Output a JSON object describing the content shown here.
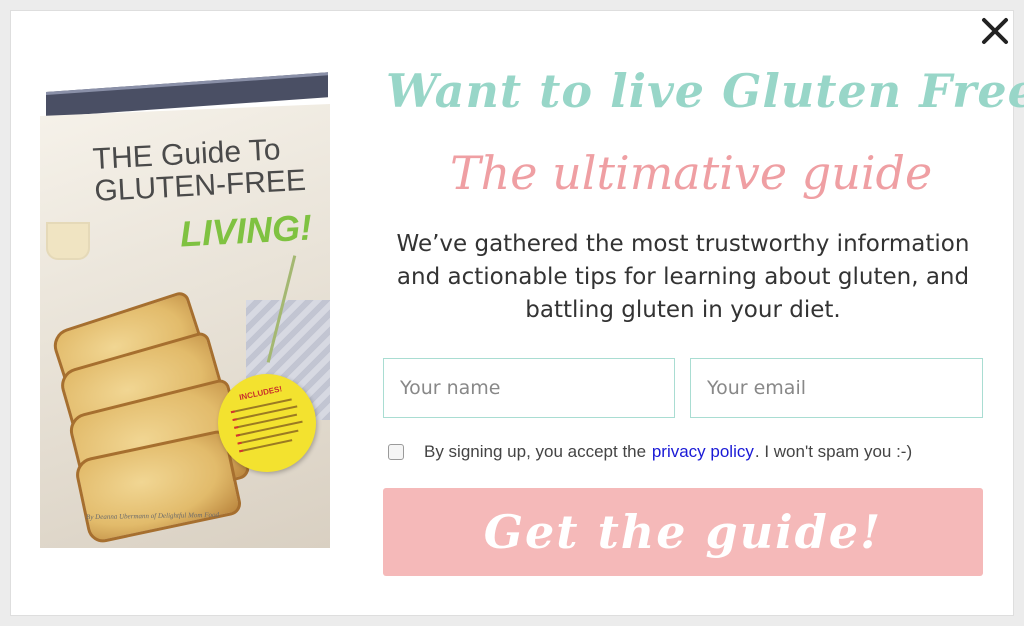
{
  "modal": {
    "close_icon": "close-icon",
    "headline": "Want to live Gluten Free?",
    "subheadline": "The ultimative guide",
    "description": "We’ve gathered the most trustworthy information and actionable tips for learning about gluten, and battling gluten in your diet.",
    "name_placeholder": "Your name",
    "email_placeholder": "Your email",
    "consent": {
      "prefix": "By signing up, you accept the",
      "link": "privacy policy",
      "suffix": ". I won't spam you :-)"
    },
    "cta_label": "Get the guide!"
  },
  "book": {
    "title_lines": [
      "THE Guide To",
      "GLUTEN-FREE"
    ],
    "title_accent": "LIVING!",
    "badge_title": "INCLUDES!",
    "author": "By Deanna Ubermann of Delightful Mom Food"
  },
  "colors": {
    "headline": "#98d6c8",
    "subheadline": "#ef9fa3",
    "cta": "#f5b9b9",
    "input_border": "#a9ddd2",
    "link": "#1a1ad6",
    "book_accent": "#7fc241",
    "badge": "#f3e22f"
  }
}
